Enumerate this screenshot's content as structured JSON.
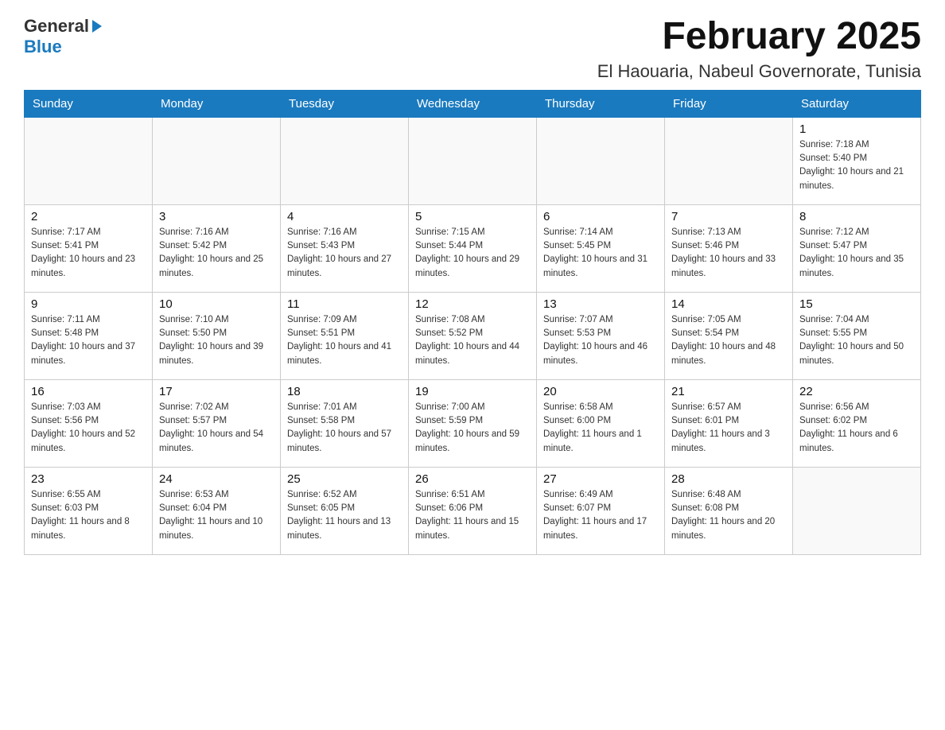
{
  "header": {
    "logo_general": "General",
    "logo_blue": "Blue",
    "month_title": "February 2025",
    "location": "El Haouaria, Nabeul Governorate, Tunisia"
  },
  "weekdays": [
    "Sunday",
    "Monday",
    "Tuesday",
    "Wednesday",
    "Thursday",
    "Friday",
    "Saturday"
  ],
  "weeks": [
    [
      {
        "day": "",
        "info": ""
      },
      {
        "day": "",
        "info": ""
      },
      {
        "day": "",
        "info": ""
      },
      {
        "day": "",
        "info": ""
      },
      {
        "day": "",
        "info": ""
      },
      {
        "day": "",
        "info": ""
      },
      {
        "day": "1",
        "info": "Sunrise: 7:18 AM\nSunset: 5:40 PM\nDaylight: 10 hours and 21 minutes."
      }
    ],
    [
      {
        "day": "2",
        "info": "Sunrise: 7:17 AM\nSunset: 5:41 PM\nDaylight: 10 hours and 23 minutes."
      },
      {
        "day": "3",
        "info": "Sunrise: 7:16 AM\nSunset: 5:42 PM\nDaylight: 10 hours and 25 minutes."
      },
      {
        "day": "4",
        "info": "Sunrise: 7:16 AM\nSunset: 5:43 PM\nDaylight: 10 hours and 27 minutes."
      },
      {
        "day": "5",
        "info": "Sunrise: 7:15 AM\nSunset: 5:44 PM\nDaylight: 10 hours and 29 minutes."
      },
      {
        "day": "6",
        "info": "Sunrise: 7:14 AM\nSunset: 5:45 PM\nDaylight: 10 hours and 31 minutes."
      },
      {
        "day": "7",
        "info": "Sunrise: 7:13 AM\nSunset: 5:46 PM\nDaylight: 10 hours and 33 minutes."
      },
      {
        "day": "8",
        "info": "Sunrise: 7:12 AM\nSunset: 5:47 PM\nDaylight: 10 hours and 35 minutes."
      }
    ],
    [
      {
        "day": "9",
        "info": "Sunrise: 7:11 AM\nSunset: 5:48 PM\nDaylight: 10 hours and 37 minutes."
      },
      {
        "day": "10",
        "info": "Sunrise: 7:10 AM\nSunset: 5:50 PM\nDaylight: 10 hours and 39 minutes."
      },
      {
        "day": "11",
        "info": "Sunrise: 7:09 AM\nSunset: 5:51 PM\nDaylight: 10 hours and 41 minutes."
      },
      {
        "day": "12",
        "info": "Sunrise: 7:08 AM\nSunset: 5:52 PM\nDaylight: 10 hours and 44 minutes."
      },
      {
        "day": "13",
        "info": "Sunrise: 7:07 AM\nSunset: 5:53 PM\nDaylight: 10 hours and 46 minutes."
      },
      {
        "day": "14",
        "info": "Sunrise: 7:05 AM\nSunset: 5:54 PM\nDaylight: 10 hours and 48 minutes."
      },
      {
        "day": "15",
        "info": "Sunrise: 7:04 AM\nSunset: 5:55 PM\nDaylight: 10 hours and 50 minutes."
      }
    ],
    [
      {
        "day": "16",
        "info": "Sunrise: 7:03 AM\nSunset: 5:56 PM\nDaylight: 10 hours and 52 minutes."
      },
      {
        "day": "17",
        "info": "Sunrise: 7:02 AM\nSunset: 5:57 PM\nDaylight: 10 hours and 54 minutes."
      },
      {
        "day": "18",
        "info": "Sunrise: 7:01 AM\nSunset: 5:58 PM\nDaylight: 10 hours and 57 minutes."
      },
      {
        "day": "19",
        "info": "Sunrise: 7:00 AM\nSunset: 5:59 PM\nDaylight: 10 hours and 59 minutes."
      },
      {
        "day": "20",
        "info": "Sunrise: 6:58 AM\nSunset: 6:00 PM\nDaylight: 11 hours and 1 minute."
      },
      {
        "day": "21",
        "info": "Sunrise: 6:57 AM\nSunset: 6:01 PM\nDaylight: 11 hours and 3 minutes."
      },
      {
        "day": "22",
        "info": "Sunrise: 6:56 AM\nSunset: 6:02 PM\nDaylight: 11 hours and 6 minutes."
      }
    ],
    [
      {
        "day": "23",
        "info": "Sunrise: 6:55 AM\nSunset: 6:03 PM\nDaylight: 11 hours and 8 minutes."
      },
      {
        "day": "24",
        "info": "Sunrise: 6:53 AM\nSunset: 6:04 PM\nDaylight: 11 hours and 10 minutes."
      },
      {
        "day": "25",
        "info": "Sunrise: 6:52 AM\nSunset: 6:05 PM\nDaylight: 11 hours and 13 minutes."
      },
      {
        "day": "26",
        "info": "Sunrise: 6:51 AM\nSunset: 6:06 PM\nDaylight: 11 hours and 15 minutes."
      },
      {
        "day": "27",
        "info": "Sunrise: 6:49 AM\nSunset: 6:07 PM\nDaylight: 11 hours and 17 minutes."
      },
      {
        "day": "28",
        "info": "Sunrise: 6:48 AM\nSunset: 6:08 PM\nDaylight: 11 hours and 20 minutes."
      },
      {
        "day": "",
        "info": ""
      }
    ]
  ]
}
